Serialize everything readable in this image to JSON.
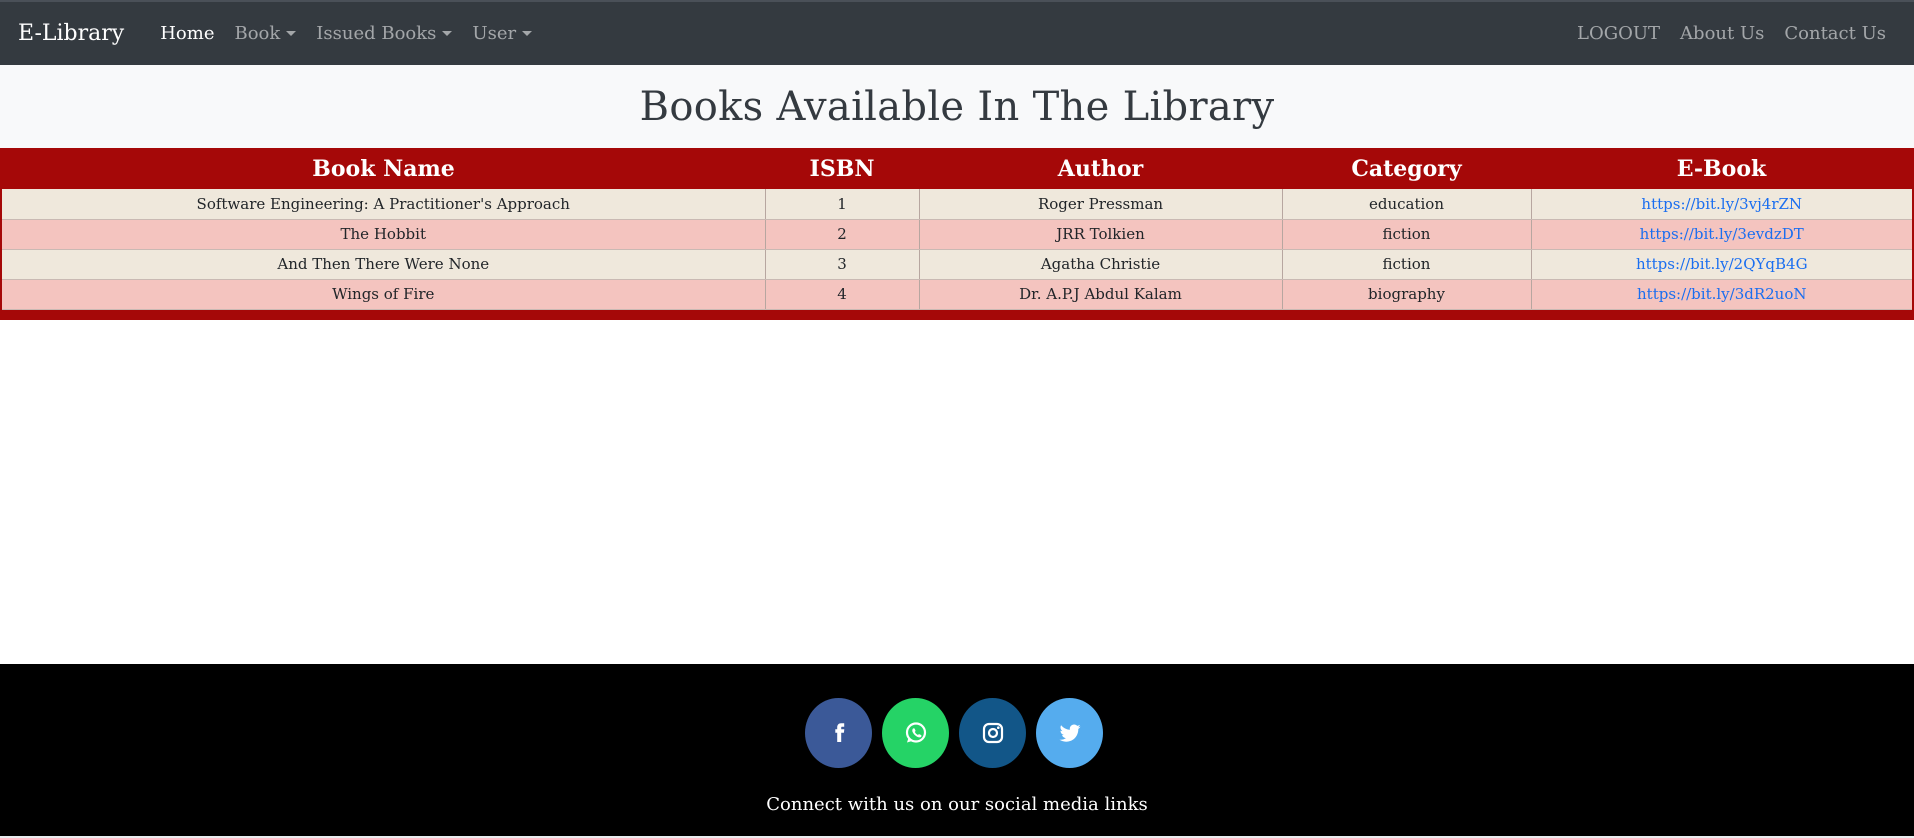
{
  "navbar": {
    "brand": "E-Library",
    "links_left": [
      {
        "label": "Home",
        "active": true,
        "dropdown": false
      },
      {
        "label": "Book",
        "active": false,
        "dropdown": true
      },
      {
        "label": "Issued Books",
        "active": false,
        "dropdown": true
      },
      {
        "label": "User",
        "active": false,
        "dropdown": true
      }
    ],
    "links_right": [
      {
        "label": "LOGOUT"
      },
      {
        "label": "About Us"
      },
      {
        "label": "Contact Us"
      }
    ]
  },
  "page": {
    "title": "Books Available In The Library"
  },
  "table": {
    "columns": [
      "Book Name",
      "ISBN",
      "Author",
      "Category",
      "E-Book"
    ],
    "rows": [
      {
        "name": "Software Engineering: A Practitioner's Approach",
        "isbn": "1",
        "author": "Roger Pressman",
        "category": "education",
        "ebook": "https://bit.ly/3vj4rZN"
      },
      {
        "name": "The Hobbit",
        "isbn": "2",
        "author": "JRR Tolkien",
        "category": "fiction",
        "ebook": "https://bit.ly/3evdzDT"
      },
      {
        "name": "And Then There Were None",
        "isbn": "3",
        "author": "Agatha Christie",
        "category": "fiction",
        "ebook": "https://bit.ly/2QYqB4G"
      },
      {
        "name": "Wings of Fire",
        "isbn": "4",
        "author": "Dr. A.P.J Abdul Kalam",
        "category": "biography",
        "ebook": "https://bit.ly/3dR2uoN"
      }
    ]
  },
  "footer": {
    "socials": [
      {
        "icon": "facebook-icon",
        "color": "#3b5998"
      },
      {
        "icon": "whatsapp-icon",
        "color": "#25d366"
      },
      {
        "icon": "instagram-icon",
        "color": "#125688"
      },
      {
        "icon": "twitter-icon",
        "color": "#55acee"
      }
    ],
    "text": "Connect with us on our social media links"
  },
  "colors": {
    "navbar_bg": "#343a40",
    "table_header_bg": "#a50808",
    "row_odd": "#efe8dc",
    "row_even": "#f4c4bf",
    "link": "#1a6ef0",
    "footer_bg": "#000000"
  }
}
